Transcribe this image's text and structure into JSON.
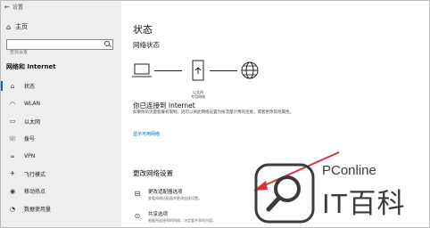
{
  "window": {
    "title": "设置"
  },
  "sidebar": {
    "home": "主页",
    "search_placeholder": "查找设置",
    "section": "网络和 Internet",
    "items": [
      {
        "label": "状态",
        "icon": "home-status-icon"
      },
      {
        "label": "WLAN",
        "icon": "wifi-icon"
      },
      {
        "label": "以太网",
        "icon": "ethernet-icon"
      },
      {
        "label": "拨号",
        "icon": "dialup-icon"
      },
      {
        "label": "VPN",
        "icon": "vpn-icon"
      },
      {
        "label": "飞行模式",
        "icon": "airplane-icon"
      },
      {
        "label": "移动热点",
        "icon": "hotspot-icon"
      },
      {
        "label": "数据使用量",
        "icon": "data-usage-icon"
      }
    ]
  },
  "main": {
    "title": "状态",
    "network_status": "网络状态",
    "ethernet_label": "以太网",
    "network_label": "专用网络",
    "connected_title": "你已连接到 Internet",
    "connected_desc": "如果你的流量套餐有限制，则可以将此网络设置为按流量计费的连接，或者更改其他属性。",
    "link": "显示可用网络",
    "change_head": "更改网络设置",
    "options": [
      {
        "title": "更改适配器选项",
        "desc": "查看网络适配器并更改连接设置。"
      },
      {
        "title": "共享选项",
        "desc": "根据所连接到的网络，决定要共享的内容。"
      }
    ]
  },
  "watermark": {
    "brand": "PConline",
    "name": "IT百科"
  },
  "colors": {
    "accent": "#0067c0",
    "arrow": "#d9333a",
    "sidebar_bg": "#eeeeee"
  }
}
